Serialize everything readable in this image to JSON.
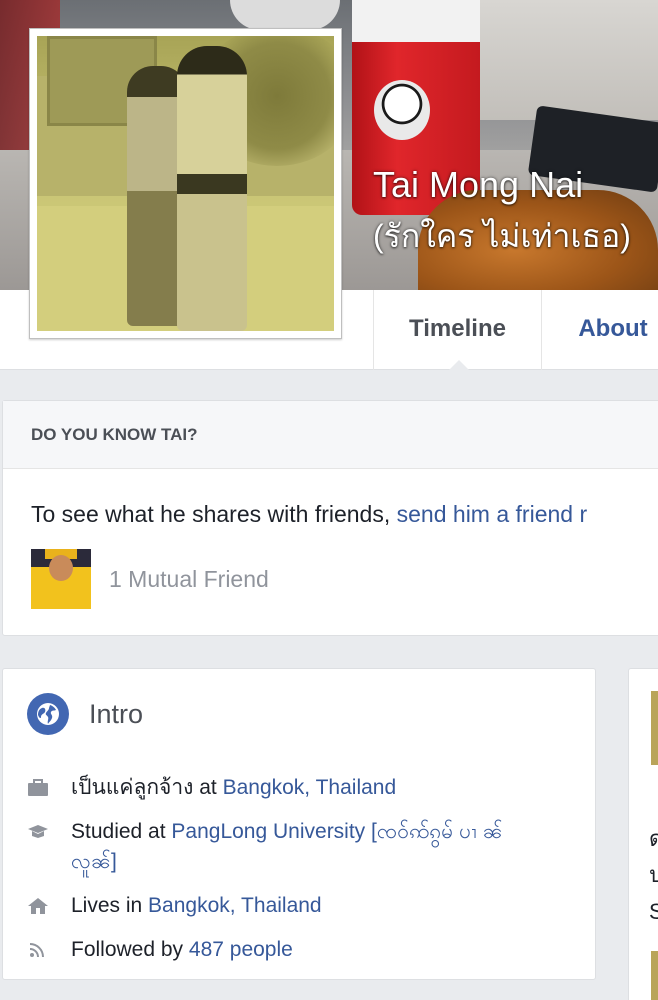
{
  "profile": {
    "name": "Tai Mong Nai",
    "alternate_name": "(รักใคร ไม่เท่าเธอ)"
  },
  "nav": {
    "tabs": [
      {
        "label": "Timeline",
        "active": true
      },
      {
        "label": "About",
        "active": false
      }
    ]
  },
  "do_you_know": {
    "title": "DO YOU KNOW TAI?",
    "text_prefix": "To see what he shares with friends, ",
    "link_text": "send him a friend r",
    "mutual_friends": "1 Mutual Friend"
  },
  "intro": {
    "title": "Intro",
    "items": [
      {
        "icon": "briefcase-icon",
        "prefix": "เป็นแค่ลูกจ้าง at ",
        "link": "Bangkok, Thailand",
        "suffix": ""
      },
      {
        "icon": "graduation-cap-icon",
        "prefix": "Studied at ",
        "link": "PangLong University [ၸဝ်ꩡ်ၵွမ် ပၢ ၼ်လူၼ်]",
        "suffix": ""
      },
      {
        "icon": "home-icon",
        "prefix": "Lives in ",
        "link": "Bangkok, Thailand",
        "suffix": ""
      },
      {
        "icon": "rss-icon",
        "prefix": "Followed by ",
        "link": "487 people",
        "suffix": ""
      }
    ]
  },
  "side_fragment": {
    "chars": [
      "ด",
      "ป",
      "S"
    ]
  },
  "colors": {
    "link": "#365899",
    "accent": "#4267b2",
    "muted": "#90949c",
    "background": "#e9ebee"
  }
}
